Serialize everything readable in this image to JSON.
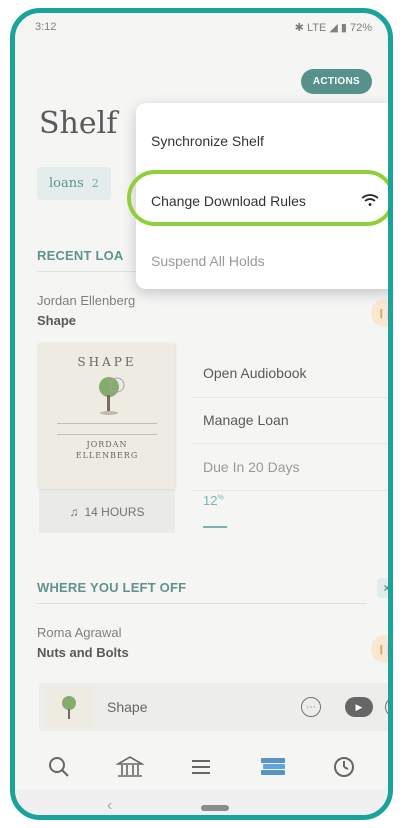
{
  "status_bar": {
    "time": "3:12",
    "network": "✱ LTE ◢ ▮ 72%"
  },
  "header": {
    "actions_label": "ACTIONS",
    "title": "Shelf"
  },
  "tabs": [
    {
      "label": "loans",
      "count": "2"
    }
  ],
  "recent_loans": {
    "section_title": "RECENT LOA",
    "book": {
      "author": "Jordan Ellenberg",
      "title": "Shape",
      "cover_title": "SHAPE",
      "cover_author": "JORDAN\nELLENBERG",
      "duration": "14 HOURS",
      "links": [
        "Open Audiobook",
        "Manage Loan"
      ],
      "due": "Due In 20 Days",
      "progress": "12",
      "progress_unit": "%"
    }
  },
  "where_left_off": {
    "section_title": "WHERE YOU LEFT OFF",
    "close_label": "×",
    "book": {
      "author": "Roma Agrawal",
      "title": "Nuts and Bolts"
    }
  },
  "mini_player": {
    "title": "Shape",
    "more_label": "⋯",
    "play_label": "▶",
    "close_label": "×"
  },
  "actions_menu": {
    "items": [
      {
        "label": "Synchronize Shelf",
        "enabled": true
      },
      {
        "label": "Change Download Rules",
        "enabled": true,
        "icon": "wifi-icon"
      },
      {
        "label": "Suspend All Holds",
        "enabled": false
      }
    ]
  },
  "bottom_nav": [
    "search-icon",
    "library-icon",
    "menu-icon",
    "shelf-icon",
    "history-icon"
  ],
  "colors": {
    "accent": "#1e6e65",
    "teal_text": "#2b6f68",
    "highlight": "#8fcf3a",
    "frame": "#19a39a"
  }
}
